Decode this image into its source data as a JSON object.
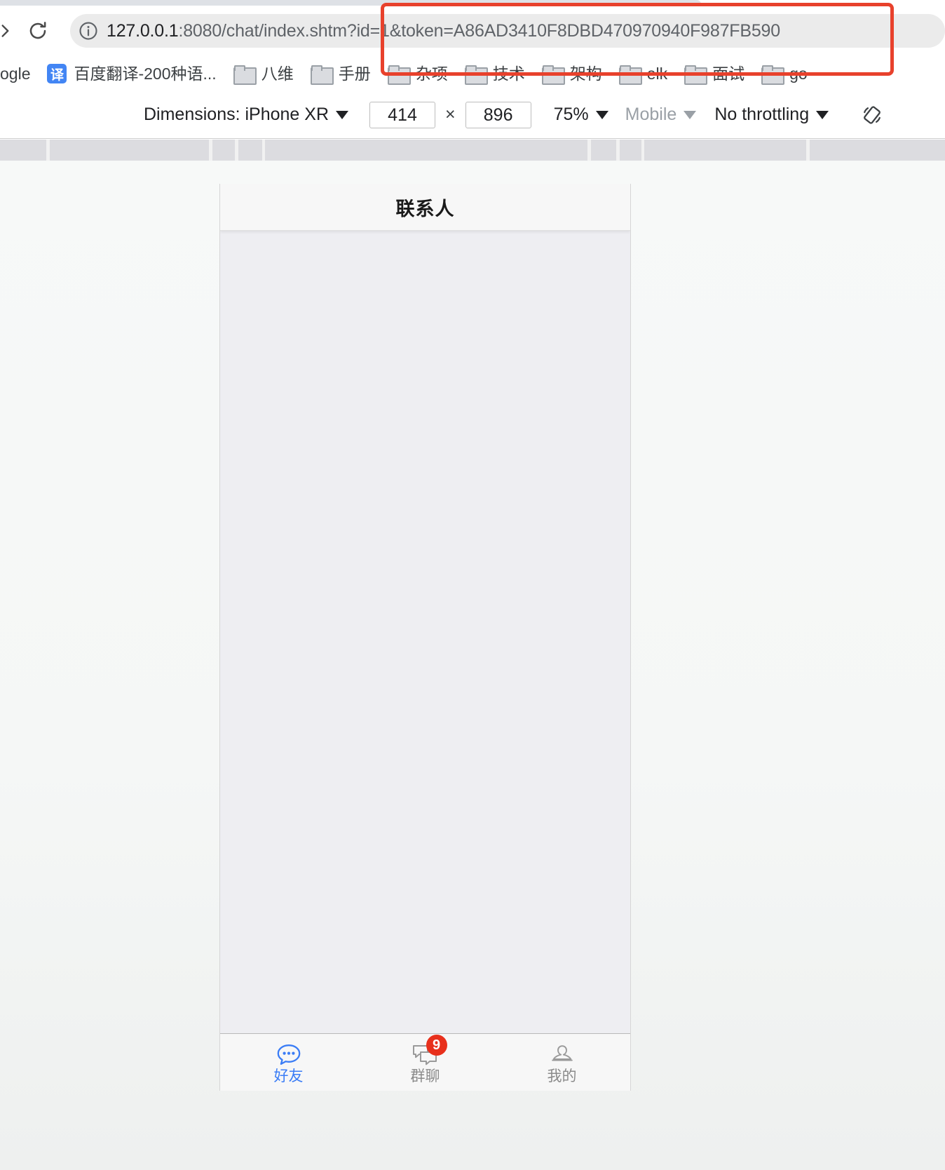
{
  "browser": {
    "nav": {
      "forward_icon": "arrow-forward-icon",
      "reload_icon": "reload-icon"
    },
    "omnibox": {
      "info_icon": "site-info-icon",
      "url_host": "127.0.0.1",
      "url_path": ":8080/chat/index.shtm",
      "url_query": "?id=1&token=A86AD3410F8DBD470970940F987FB590",
      "full_url": "127.0.0.1:8080/chat/index.shtm?id=1&token=A86AD3410F8DBD470970940F987FB590"
    },
    "bookmarks": [
      {
        "label": "ogle",
        "icon": "none"
      },
      {
        "label": "百度翻译-200种语...",
        "icon": "translate-favicon",
        "favicon_text": "译"
      },
      {
        "label": "八维",
        "icon": "folder-icon"
      },
      {
        "label": "手册",
        "icon": "folder-icon"
      },
      {
        "label": "杂项",
        "icon": "folder-icon"
      },
      {
        "label": "技术",
        "icon": "folder-icon"
      },
      {
        "label": "架构",
        "icon": "folder-icon"
      },
      {
        "label": "elk",
        "icon": "folder-icon"
      },
      {
        "label": "面试",
        "icon": "folder-icon"
      },
      {
        "label": "go",
        "icon": "folder-icon"
      }
    ],
    "annotation": {
      "color": "#e8412c",
      "shape": "rectangle-highlight"
    }
  },
  "device_toolbar": {
    "dimensions_label": "Dimensions: iPhone XR",
    "width_value": "414",
    "height_value": "896",
    "multiply_symbol": "×",
    "zoom_label": "75%",
    "device_type_label": "Mobile",
    "throttling_label": "No throttling",
    "rotate_icon": "rotate-device-icon"
  },
  "app": {
    "header": {
      "title": "联系人"
    },
    "tabs": [
      {
        "label": "好友",
        "icon": "chat-bubble-icon",
        "active": true,
        "badge": null
      },
      {
        "label": "群聊",
        "icon": "group-chat-icon",
        "active": false,
        "badge": "9"
      },
      {
        "label": "我的",
        "icon": "person-icon",
        "active": false,
        "badge": null
      }
    ],
    "colors": {
      "accent": "#3b7df6",
      "badge": "#e8301c",
      "body_background": "#eeeef2",
      "header_background": "#f7f7f7",
      "inactive_label": "#8a8a8a"
    },
    "content_items": []
  }
}
